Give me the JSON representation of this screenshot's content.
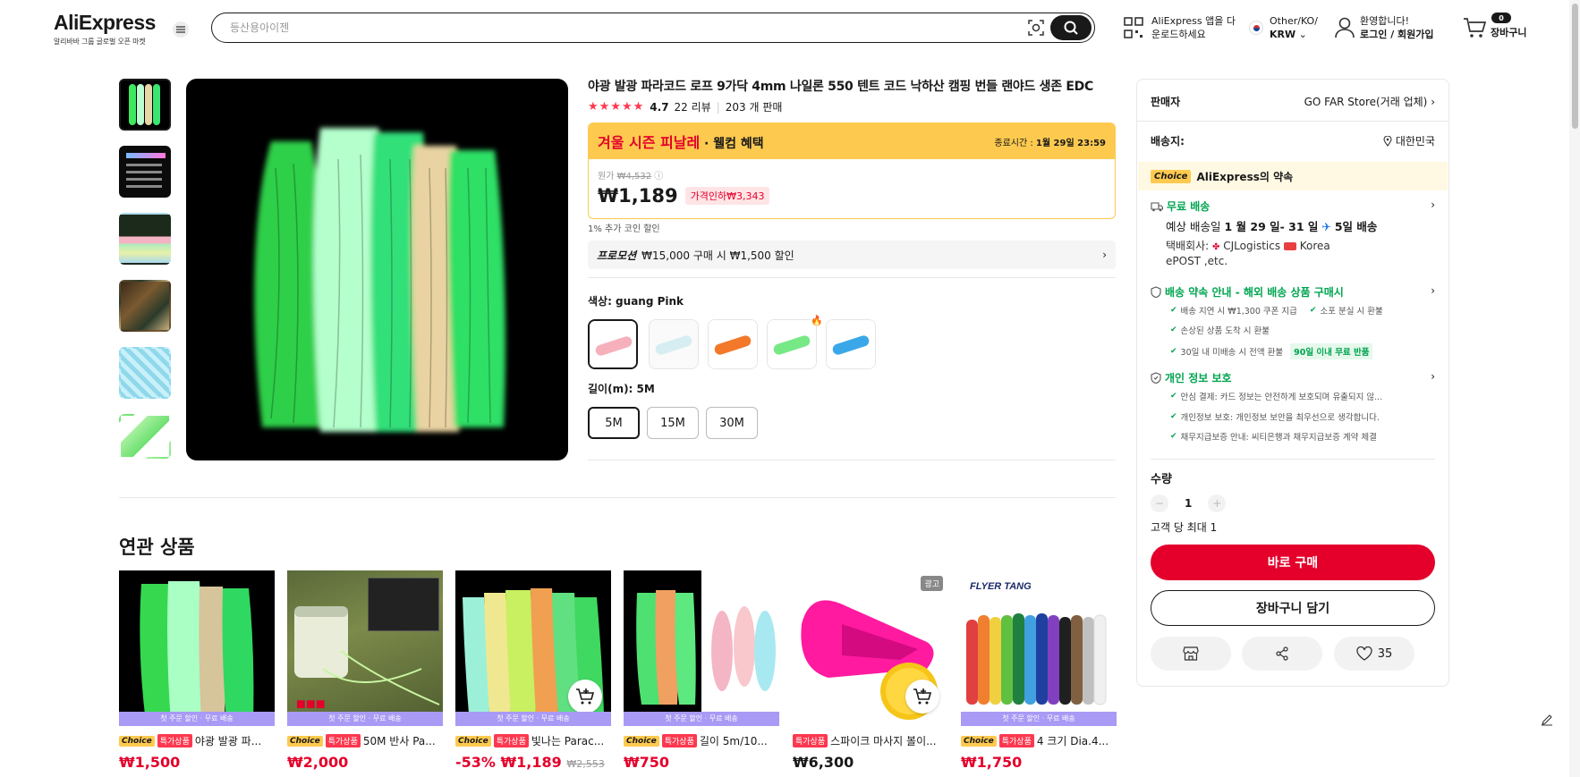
{
  "header": {
    "logo": "AliExpress",
    "logo_sub": "알리바바 그룹 글로벌 오픈 마켓",
    "search_placeholder": "등산용아이젠",
    "app_line1": "AliExpress 앱을 다",
    "app_line2": "운로드하세요",
    "region_line1": "Other/KO/",
    "region_line2": "KRW",
    "account_line1": "환영합니다!",
    "account_line2": "로그인 / 회원가입",
    "cart_count": "0",
    "cart_label": "장바구니"
  },
  "product": {
    "title": "야광 발광 파라코드 로프 9가닥 4mm 나일론 550 텐트 코드 낙하산 캠핑 번들 랜야드 생존 EDC",
    "stars": "★★★★★",
    "rating": "4.7",
    "reviews": "22 리뷰",
    "sold": "203 개 판매",
    "sale_title": "겨울 시즌 피날레",
    "sale_sub": " · 웰컴 혜택",
    "end_label": "종료시간 :",
    "end_time": "1월 29일 23:59",
    "orig_label": "원가",
    "orig_price": "₩4,532",
    "price": "₩1,189",
    "discount": "가격인하₩3,343",
    "coin": "1% 추가 코인 할인",
    "promo_label": "프로모션",
    "promo_text": "₩15,000 구매 시 ₩1,500 할인",
    "color_label": "색상: guang Pink",
    "length_label": "길이(m): 5M",
    "sizes": [
      "5M",
      "15M",
      "30M"
    ]
  },
  "panel": {
    "seller_label": "판매자",
    "seller_name": "GO FAR Store(거래 업체)",
    "ship_to_label": "배송지:",
    "ship_to": "대한민국",
    "choice_tag": "Choice",
    "choice_text": "AliExpress의 약속",
    "free_ship": "무료 배송",
    "eta_prefix": "예상 배송일",
    "eta_dates": "1 월 29 일- 31 일",
    "eta_days": "5일 배송",
    "courier_label": "택배회사:",
    "courier_1": "CJLogistics",
    "courier_2": "Korea",
    "courier_3": "ePOST ,etc.",
    "promise_title": "배송 약속 안내 - 해외 배송 상품 구매시",
    "promise_1": "배송 지연 시 ₩1,300 쿠폰 지급",
    "promise_2": "소포 분실 시 환불",
    "promise_3": "손상된 상품 도착 시 환불",
    "promise_4": "30일 내 미배송 시 전액 환불",
    "promise_badge": "90일 이내 무료 반품",
    "privacy_title": "개인 정보 보호",
    "privacy_1": "안심 결제: 카드 정보는 안전하게 보호되며 유출되지 않...",
    "privacy_2": "개인정보 보호: 개인정보 보안을 최우선으로 생각합니다.",
    "privacy_3": "채무지급보증 안내: 씨티은행과 채무지급보증 계약 체결",
    "qty_label": "수량",
    "qty_value": "1",
    "qty_limit": "고객 당 최대 1",
    "buy_now": "바로 구매",
    "add_cart": "장바구니 담기",
    "wish_count": "35"
  },
  "related": {
    "title": "연관 상품",
    "strip": "첫 주문 할인 · 무료 배송",
    "items": [
      {
        "choice": "Choice",
        "tag": "특가상품",
        "name": "야광 발광 파...",
        "price": "₩1,500"
      },
      {
        "choice": "Choice",
        "tag": "특가상품",
        "name": "50M 반사 Pa...",
        "price": "₩2,000"
      },
      {
        "choice": "Choice",
        "tag": "특가상품",
        "name": "빛나는 Parac...",
        "price": "-53% ₩1,189",
        "orig": "₩2,553"
      },
      {
        "choice": "Choice",
        "tag": "특가상품",
        "name": "길이 5m/10...",
        "price": "₩750"
      },
      {
        "tag": "특가상품",
        "name": "스파이크 마사지 볼이...",
        "price": "₩6,300",
        "ad": "광고"
      },
      {
        "choice": "Choice",
        "tag": "특가상품",
        "name": "4 크기 Dia.4...",
        "price": "₩1,750",
        "brand": "FLYER TANG"
      }
    ]
  },
  "icons": [
    "menu-icon",
    "camera-search-icon",
    "search-icon",
    "qr-code-icon",
    "korea-flag-icon",
    "user-icon",
    "cart-icon",
    "location-pin-icon",
    "truck-icon",
    "shield-icon",
    "lock-shield-icon",
    "store-icon",
    "share-icon",
    "heart-icon",
    "edit-icon"
  ]
}
